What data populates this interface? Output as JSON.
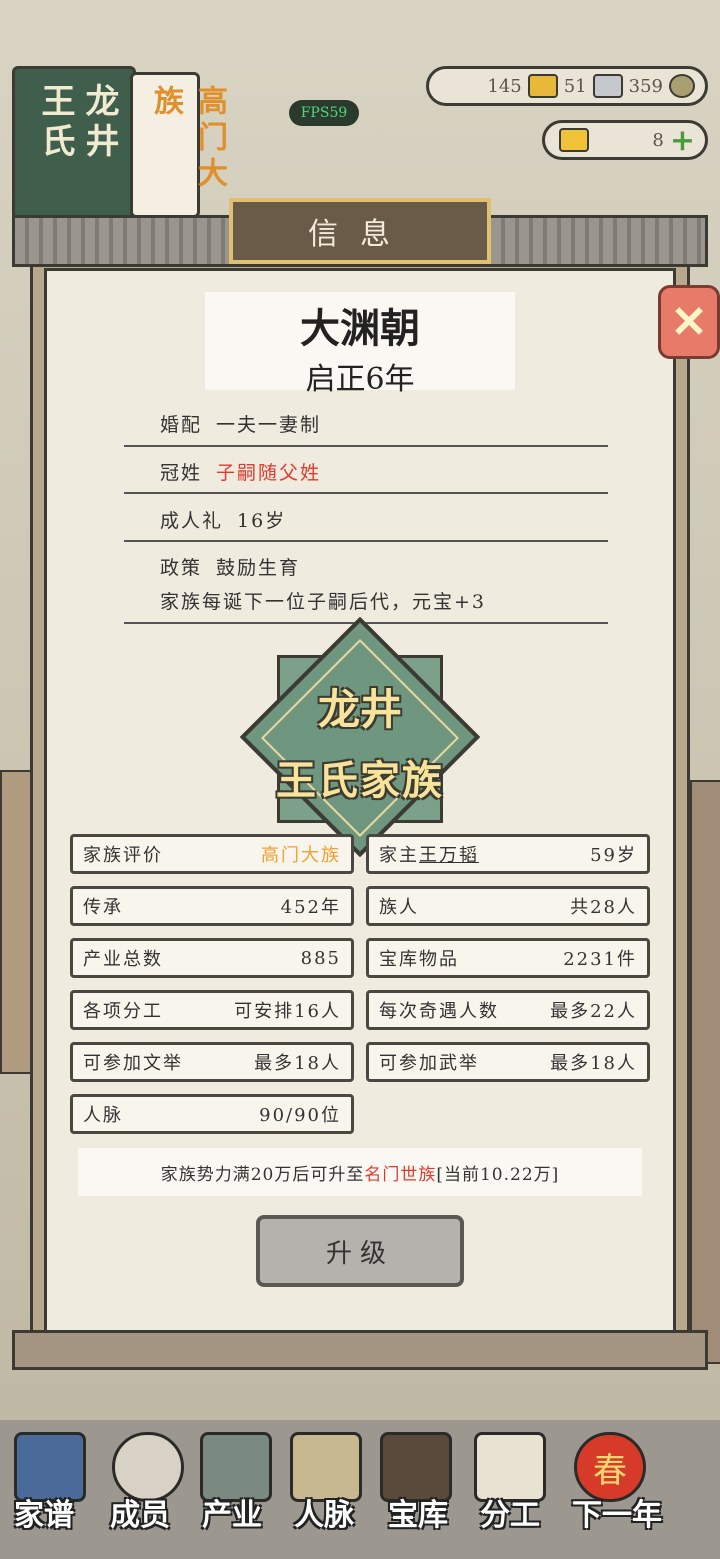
{
  "top": {
    "banner_green": "龙井王氏",
    "banner_green_col1": "龙井",
    "banner_green_col2": "王氏",
    "banner_white": "高门大族",
    "fps": "FPS59",
    "res1": "145",
    "res2": "51",
    "res3": "359",
    "yuanbao": "8"
  },
  "panel": {
    "title": "信息",
    "dynasty": "大渊朝",
    "era": "启正6年",
    "rows": [
      {
        "label": "婚配",
        "value": "一夫一妻制"
      },
      {
        "label": "冠姓",
        "value": "子嗣随父姓"
      },
      {
        "label": "成人礼",
        "value": "16岁"
      },
      {
        "label": "政策",
        "value": "鼓励生育"
      }
    ],
    "policy_desc": "家族每诞下一位子嗣后代，元宝+3",
    "emblem_line1": "龙井",
    "emblem_line2": "王氏家族",
    "stats": {
      "rating_label": "家族评价",
      "rating_value": "高门大族",
      "head_label": "家主",
      "head_name": "王万韬",
      "head_age": "59岁",
      "inherit_label": "传承",
      "inherit_value": "452年",
      "members_label": "族人",
      "members_value": "共28人",
      "property_label": "产业总数",
      "property_value": "885",
      "treasury_label": "宝库物品",
      "treasury_value": "2231件",
      "work_label": "各项分工",
      "work_value": "可安排16人",
      "encounter_label": "每次奇遇人数",
      "encounter_value": "最多22人",
      "civil_label": "可参加文举",
      "civil_value": "最多18人",
      "military_label": "可参加武举",
      "military_value": "最多18人",
      "network_label": "人脉",
      "network_value": "90/90位"
    },
    "notice_pre": "家族势力满20万后可升至",
    "notice_rank": "名门世族",
    "notice_post": "[当前10.22万]",
    "upgrade_button": "升级"
  },
  "nav": [
    "家谱",
    "成员",
    "产业",
    "人脉",
    "宝库",
    "分工",
    "下一年"
  ],
  "nav_spring_badge": "春",
  "colors": {
    "accent_red": "#e23a2f",
    "accent_orange": "#f0a030",
    "paper": "#efebde"
  }
}
